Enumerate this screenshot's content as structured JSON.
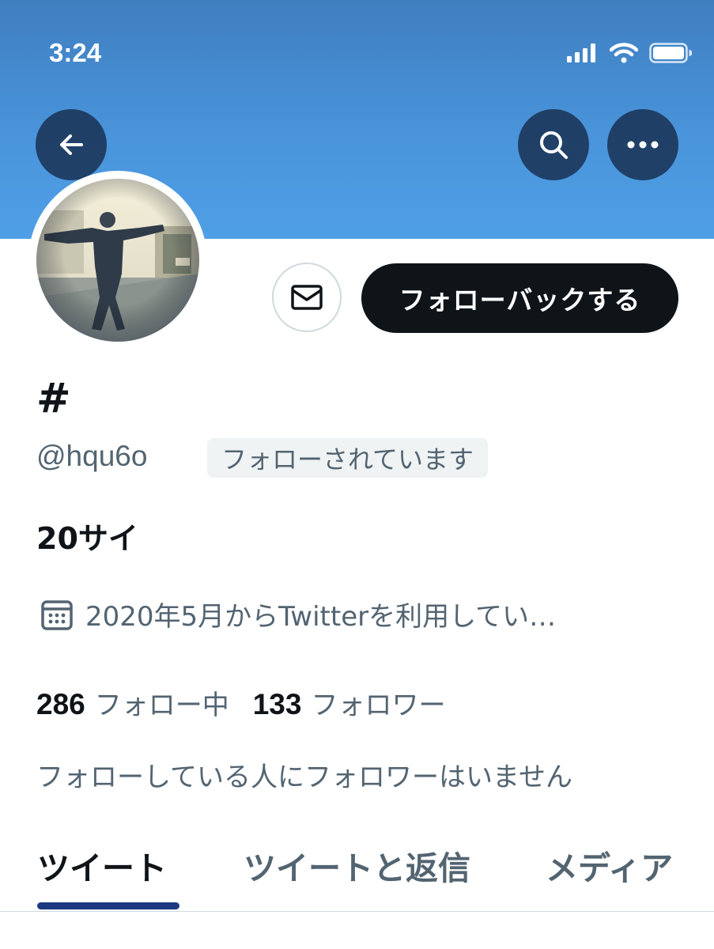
{
  "status_bar": {
    "time": "3:24"
  },
  "nav": {
    "back_icon": "arrow-left-icon",
    "search_icon": "search-icon",
    "more_icon": "more-horizontal-icon"
  },
  "profile": {
    "display_name": "#",
    "handle": "@hqu6o",
    "follows_you_badge": "フォローされています",
    "bio": "20サイ",
    "joined": "2020年5月からTwitterを利用してい…",
    "following_count": "286",
    "following_label": "フォロー中",
    "followers_count": "133",
    "followers_label": "フォロワー",
    "known_followers": "フォローしている人にフォロワーはいません"
  },
  "actions": {
    "message_icon": "envelope-icon",
    "follow_back_label": "フォローバックする"
  },
  "tabs": [
    {
      "label": "ツイート",
      "active": true
    },
    {
      "label": "ツイートと返信",
      "active": false
    },
    {
      "label": "メディア",
      "active": false
    }
  ],
  "colors": {
    "banner": "#4a95dc",
    "primary_button": "#0f1419",
    "tab_indicator": "#1d3a80",
    "secondary_text": "#536471"
  }
}
